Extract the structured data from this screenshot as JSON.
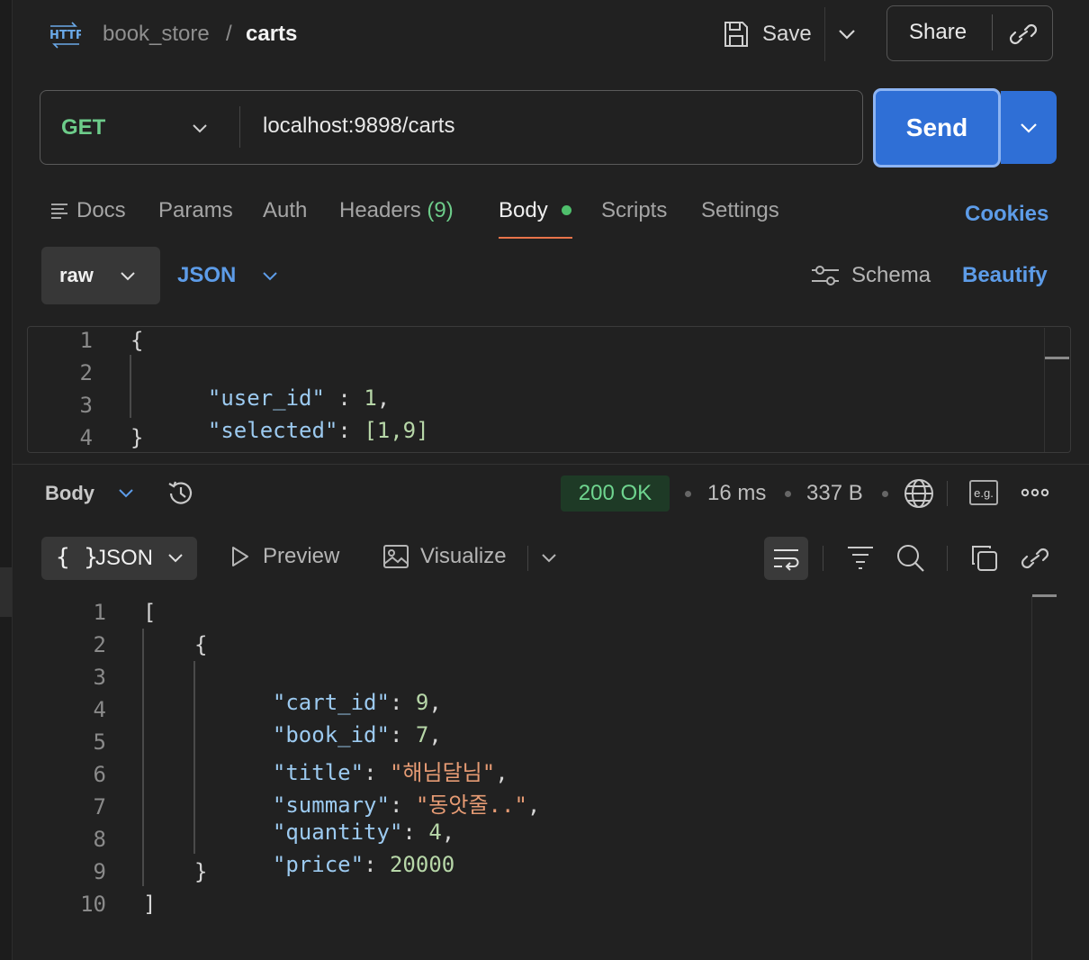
{
  "header": {
    "protocol_icon": "http-icon",
    "breadcrumb_parent": "book_store",
    "breadcrumb_separator": "/",
    "breadcrumb_current": "carts",
    "save_label": "Save",
    "share_label": "Share"
  },
  "request": {
    "method": "GET",
    "url": "localhost:9898/carts",
    "send_label": "Send"
  },
  "tabs": [
    {
      "label": "Docs"
    },
    {
      "label": "Params"
    },
    {
      "label": "Auth"
    },
    {
      "label": "Headers",
      "count": "(9)"
    },
    {
      "label": "Body",
      "active": true
    },
    {
      "label": "Scripts"
    },
    {
      "label": "Settings"
    }
  ],
  "cookies_label": "Cookies",
  "body_options": {
    "mode": "raw",
    "language": "JSON",
    "schema_label": "Schema",
    "beautify_label": "Beautify"
  },
  "request_body": {
    "line_numbers": [
      "1",
      "2",
      "3",
      "4"
    ],
    "lines": {
      "open": "{",
      "key1": "\"user_id\"",
      "sep1": " : ",
      "val1": "1",
      "comma1": ",",
      "key2": "\"selected\"",
      "sep2": ": ",
      "val2": "[1,9]",
      "close": "}"
    }
  },
  "response": {
    "section_label": "Body",
    "status": "200 OK",
    "time": "16 ms",
    "size": "337 B",
    "example_label": "e.g.",
    "view_label": "JSON",
    "braces": "{ }",
    "preview_label": "Preview",
    "visualize_label": "Visualize",
    "line_numbers": [
      "1",
      "2",
      "3",
      "4",
      "5",
      "6",
      "7",
      "8",
      "9",
      "10"
    ],
    "body": {
      "open_array": "[",
      "open_obj": "{",
      "fields": [
        {
          "key": "\"cart_id\"",
          "value": "9",
          "type": "num",
          "comma": ","
        },
        {
          "key": "\"book_id\"",
          "value": "7",
          "type": "num",
          "comma": ","
        },
        {
          "key": "\"title\"",
          "value": "\"해님달님\"",
          "type": "str",
          "comma": ","
        },
        {
          "key": "\"summary\"",
          "value": "\"동앗줄..\"",
          "type": "str",
          "comma": ","
        },
        {
          "key": "\"quantity\"",
          "value": "4",
          "type": "num",
          "comma": ","
        },
        {
          "key": "\"price\"",
          "value": "20000",
          "type": "num",
          "comma": ""
        }
      ],
      "close_obj": "}",
      "close_array": "]"
    }
  },
  "colors": {
    "background": "#212121",
    "accent_blue": "#2f6fd6",
    "link_blue": "#5d9ce8",
    "method_green": "#6dcc8a",
    "status_green": "#6fd58f",
    "tab_underline": "#e8734a"
  }
}
